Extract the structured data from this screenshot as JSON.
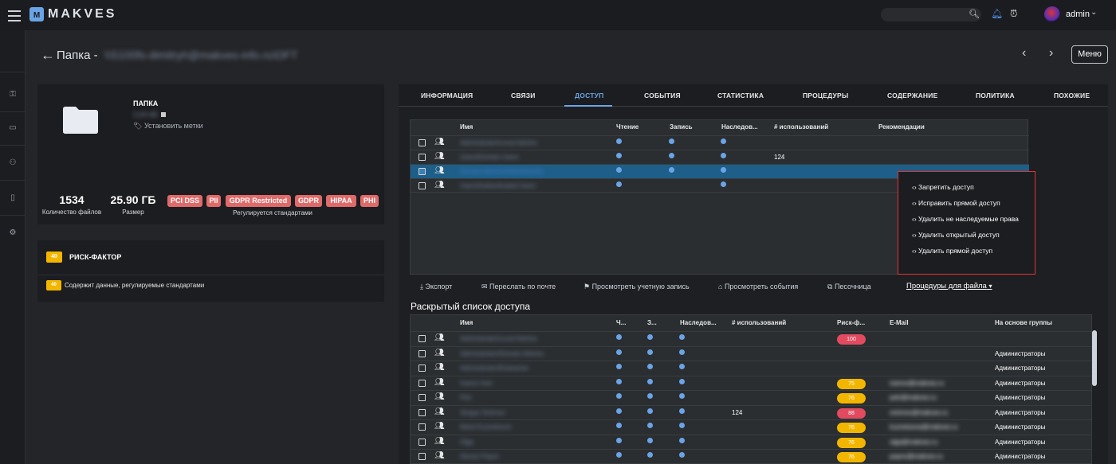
{
  "app": {
    "brand": "MAKVES",
    "logo_letter": "M",
    "user": "admin"
  },
  "header": {
    "title": "Папка -",
    "title_blurred": "\\\\S100fs-dimitryh@makves-info.ru\\DFT",
    "menu_label": "Меню"
  },
  "info_card": {
    "folder_label": "ПАПКА",
    "folder_sub": "0,00 kB",
    "set_tags": "Установить метки",
    "files_count": "1534",
    "files_label": "Количество файлов",
    "size": "25.90 ГБ",
    "size_label": "Размер",
    "badges": [
      "PCI DSS",
      "PII",
      "GDPR Restricted",
      "GDPR",
      "HIPAA",
      "PHI"
    ],
    "badges_label": "Регулируется стандартами"
  },
  "risk": {
    "score": "40",
    "title": "РИСК-ФАКТОР",
    "item_score": "40",
    "item_text": "Содержит данные, регулируемые стандартами"
  },
  "tabs": [
    "ИНФОРМАЦИЯ",
    "СВЯЗИ",
    "ДОСТУП",
    "СОБЫТИЯ",
    "СТАТИСТИКА",
    "ПРОЦЕДУРЫ",
    "СОДЕРЖАНИЕ",
    "ПОЛИТИКА",
    "ПОХОЖИЕ"
  ],
  "active_tab": "ДОСТУП",
  "access_table": {
    "headers": [
      "Имя",
      "Чтение",
      "Запись",
      "Наследов...",
      "# использований",
      "Рекомендации"
    ],
    "rows": [
      {
        "name": "Administrator\\Local Admins",
        "read": true,
        "write": true,
        "inherit": true,
        "uses": ""
      },
      {
        "name": "Users\\Domain Users",
        "read": true,
        "write": true,
        "inherit": true,
        "uses": "124"
      },
      {
        "name": "Domain Admins\\Administrator",
        "read": true,
        "write": true,
        "inherit": true,
        "uses": "",
        "selected": true
      },
      {
        "name": "Users\\Authenticated Users",
        "read": true,
        "write": false,
        "inherit": true,
        "uses": ""
      }
    ]
  },
  "procedures_menu": [
    "Запретить доступ",
    "Исправить прямой доступ",
    "Удалить не наследуемые права",
    "Удалить открытый доступ",
    "Удалить прямой доступ"
  ],
  "actions": {
    "export": "Экспорт",
    "mail": "Переслать по почте",
    "account": "Просмотреть учетную запись",
    "events": "Просмотреть события",
    "sandbox": "Песочница",
    "procedures": "Процедуры для файла"
  },
  "expanded": {
    "title": "Раскрытый список доступа",
    "headers": [
      "Имя",
      "Ч...",
      "З...",
      "Наследов...",
      "# использований",
      "Риск-ф...",
      "E-Mail",
      "На основе группы"
    ],
    "rows": [
      {
        "name": "Administrator\\Local Admins",
        "uses": "",
        "risk": "100",
        "risk_color": "red",
        "email": "",
        "group": ""
      },
      {
        "name": "Administrator\\Domain Admins",
        "uses": "",
        "risk": "",
        "risk_color": "",
        "email": "",
        "group": "Администраторы"
      },
      {
        "name": "Administrator\\Enterprise",
        "uses": "",
        "risk": "",
        "risk_color": "",
        "email": "",
        "group": "Администраторы"
      },
      {
        "name": "Ivanov Ivan",
        "uses": "",
        "risk": "75",
        "risk_color": "yel",
        "email": "ivanov@makves.ru",
        "group": "Администраторы"
      },
      {
        "name": "Petr",
        "uses": "",
        "risk": "76",
        "risk_color": "yel",
        "email": "petr@makves.ru",
        "group": "Администраторы"
      },
      {
        "name": "Sergey Smirnov",
        "uses": "124",
        "risk": "88",
        "risk_color": "red",
        "email": "smirnov@makves.ru",
        "group": "Администраторы"
      },
      {
        "name": "Maria Kuznetsova",
        "uses": "",
        "risk": "76",
        "risk_color": "yel",
        "email": "kuznetsova@makves.ru",
        "group": "Администраторы"
      },
      {
        "name": "Olga",
        "uses": "",
        "risk": "76",
        "risk_color": "yel",
        "email": "olga@makves.ru",
        "group": "Администраторы"
      },
      {
        "name": "Alexey Popov",
        "uses": "",
        "risk": "76",
        "risk_color": "yel",
        "email": "popov@makves.ru",
        "group": "Администраторы"
      }
    ]
  },
  "colors": {
    "accent": "#6aa4e6",
    "badge_red": "#e06a6a",
    "risk_yellow": "#f3b600",
    "risk_red": "#e24a5f",
    "selected_row": "#1d5f88"
  }
}
